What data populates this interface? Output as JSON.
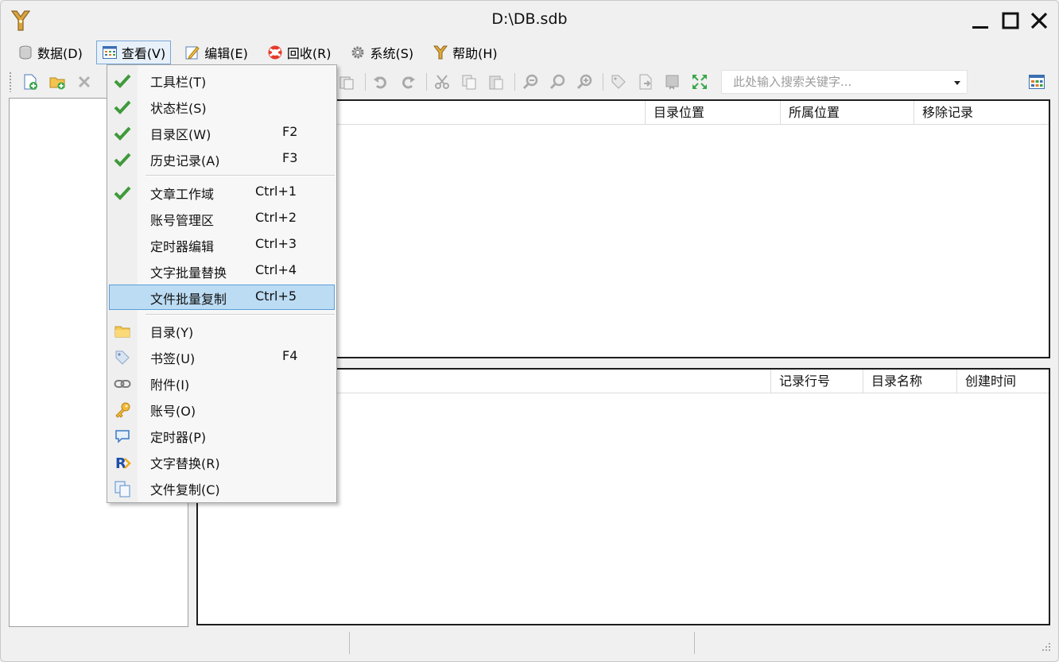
{
  "window": {
    "title": "D:\\DB.sdb"
  },
  "menubar": [
    {
      "label": "数据(D)",
      "icon": "database-icon"
    },
    {
      "label": "查看(V)",
      "icon": "view-grid-icon"
    },
    {
      "label": "编辑(E)",
      "icon": "edit-icon"
    },
    {
      "label": "回收(R)",
      "icon": "lifebuoy-icon"
    },
    {
      "label": "系统(S)",
      "icon": "gear-icon"
    },
    {
      "label": "帮助(H)",
      "icon": "help-y-icon"
    }
  ],
  "toolbar": {
    "search_placeholder": "此处输入搜索关键字..."
  },
  "top_pane": {
    "columns": [
      "目录位置",
      "所属位置",
      "移除记录"
    ]
  },
  "bottom_pane": {
    "columns": [
      "记录行号",
      "目录名称",
      "创建时间"
    ]
  },
  "view_menu": {
    "items": [
      {
        "label": "工具栏(T)",
        "shortcut": "",
        "checked": true
      },
      {
        "label": "状态栏(S)",
        "shortcut": "",
        "checked": true
      },
      {
        "label": "目录区(W)",
        "shortcut": "F2",
        "checked": true
      },
      {
        "label": "历史记录(A)",
        "shortcut": "F3",
        "checked": true
      },
      {
        "label": "文章工作域",
        "shortcut": "Ctrl+1",
        "checked": true
      },
      {
        "label": "账号管理区",
        "shortcut": "Ctrl+2",
        "checked": false
      },
      {
        "label": "定时器编辑",
        "shortcut": "Ctrl+3",
        "checked": false
      },
      {
        "label": "文字批量替换",
        "shortcut": "Ctrl+4",
        "checked": false
      },
      {
        "label": "文件批量复制",
        "shortcut": "Ctrl+5",
        "checked": false,
        "highlighted": true
      },
      {
        "label": "目录(Y)",
        "shortcut": "",
        "icon": "folder-icon"
      },
      {
        "label": "书签(U)",
        "shortcut": "F4",
        "icon": "tag-icon"
      },
      {
        "label": "附件(I)",
        "shortcut": "",
        "icon": "chain-link-icon"
      },
      {
        "label": "账号(O)",
        "shortcut": "",
        "icon": "key-icon"
      },
      {
        "label": "定时器(P)",
        "shortcut": "",
        "icon": "speech-bubble-icon"
      },
      {
        "label": "文字替换(R)",
        "shortcut": "",
        "icon": "replace-r-icon"
      },
      {
        "label": "文件复制(C)",
        "shortcut": "",
        "icon": "copy-files-icon"
      }
    ]
  },
  "colors": {
    "highlight_bg": "#bcdcf4",
    "highlight_border": "#5c9fd8",
    "check_green": "#3f9a3a"
  }
}
